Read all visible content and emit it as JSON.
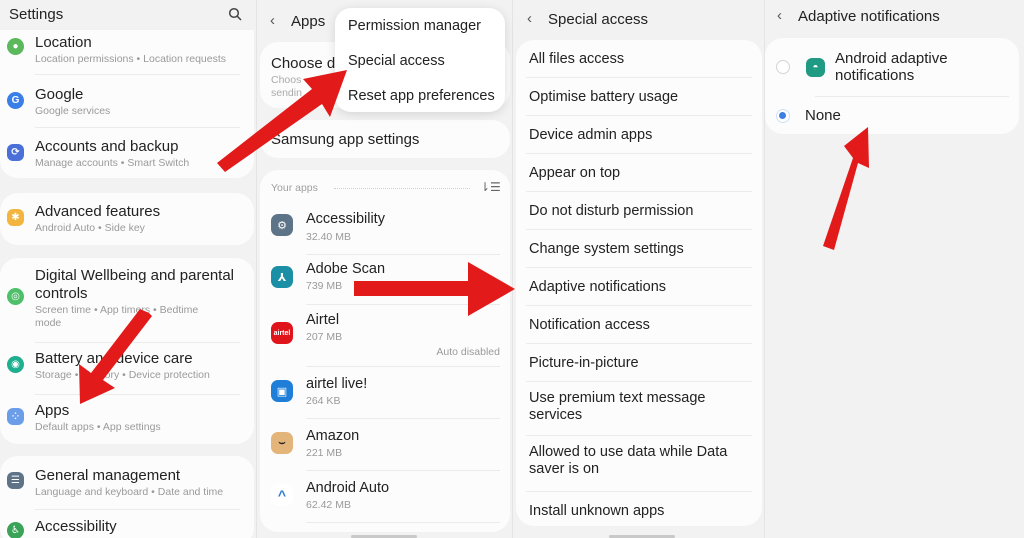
{
  "panel_settings": {
    "title": "Settings",
    "search_icon": "search-icon",
    "items": [
      {
        "title": "Location",
        "subtitle": "Location permissions  •  Location requests",
        "icon": "location-icon",
        "color": "#5cb85c"
      },
      {
        "title": "Google",
        "subtitle": "Google services",
        "icon": "google-icon",
        "color": "#3a7ee8"
      },
      {
        "title": "Accounts and backup",
        "subtitle": "Manage accounts  •  Smart Switch",
        "icon": "sync-icon",
        "color": "#4a6fd8"
      },
      {
        "title": "Advanced features",
        "subtitle": "Android Auto  •  Side key",
        "icon": "star-gear-icon",
        "color": "#f2b640"
      },
      {
        "title": "Digital Wellbeing and parental controls",
        "subtitle": "Screen time  •  App timers  •  Bedtime mode",
        "icon": "wellbeing-icon",
        "color": "#4fbf6a"
      },
      {
        "title": "Battery and device care",
        "subtitle": "Storage  •  Memory  •  Device protection",
        "icon": "device-care-icon",
        "color": "#1fae90"
      },
      {
        "title": "Apps",
        "subtitle": "Default apps  •  App settings",
        "icon": "apps-grid-icon",
        "color": "#6c9de8"
      },
      {
        "title": "General management",
        "subtitle": "Language and keyboard  •  Date and time",
        "icon": "sliders-icon",
        "color": "#5d7387"
      },
      {
        "title": "Accessibility",
        "subtitle": "",
        "icon": "accessibility-icon",
        "color": "#3aa357"
      }
    ]
  },
  "panel_apps": {
    "title": "Apps",
    "back_icon": "back-chevron-icon",
    "choose_default_title": "Choose de",
    "choose_default_sub1": "Choos",
    "choose_default_sub2": "sendin",
    "menu": [
      "Permission manager",
      "Special access",
      "Reset app preferences"
    ],
    "samsung_app_settings": "Samsung app settings",
    "your_apps_label": "Your apps",
    "sort_icon": "sort-icon",
    "apps": [
      {
        "name": "Accessibility",
        "size": "32.40 MB",
        "status": "",
        "icon": "gear-icon",
        "color": "#5d7387"
      },
      {
        "name": "Adobe Scan",
        "size": "739 MB",
        "status": "",
        "icon": "adobe-scan-icon",
        "color": "#1a8fa6"
      },
      {
        "name": "Airtel",
        "size": "207 MB",
        "status": "Auto disabled",
        "icon": "airtel-icon",
        "color": "#e0141b"
      },
      {
        "name": "airtel live!",
        "size": "264 KB",
        "status": "",
        "icon": "airtel-live-icon",
        "color": "#1f7fd8"
      },
      {
        "name": "Amazon",
        "size": "221 MB",
        "status": "",
        "icon": "amazon-icon",
        "color": "#e3b57a"
      },
      {
        "name": "Android Auto",
        "size": "62.42 MB",
        "status": "",
        "icon": "android-auto-icon",
        "color": "#ffffff"
      }
    ]
  },
  "panel_special": {
    "title": "Special access",
    "items": [
      "All files access",
      "Optimise battery usage",
      "Device admin apps",
      "Appear on top",
      "Do not disturb permission",
      "Change system settings",
      "Adaptive notifications",
      "Notification access",
      "Picture-in-picture",
      "Use premium text message services",
      "Allowed to use data while Data saver is on",
      "Install unknown apps"
    ]
  },
  "panel_adaptive": {
    "title": "Adaptive notifications",
    "options": [
      {
        "label": "Android adaptive notifications",
        "selected": false,
        "icon": "android-icon",
        "color": "#1f9b84"
      },
      {
        "label": "None",
        "selected": true
      }
    ]
  },
  "annotation_color": "#e31a1a"
}
